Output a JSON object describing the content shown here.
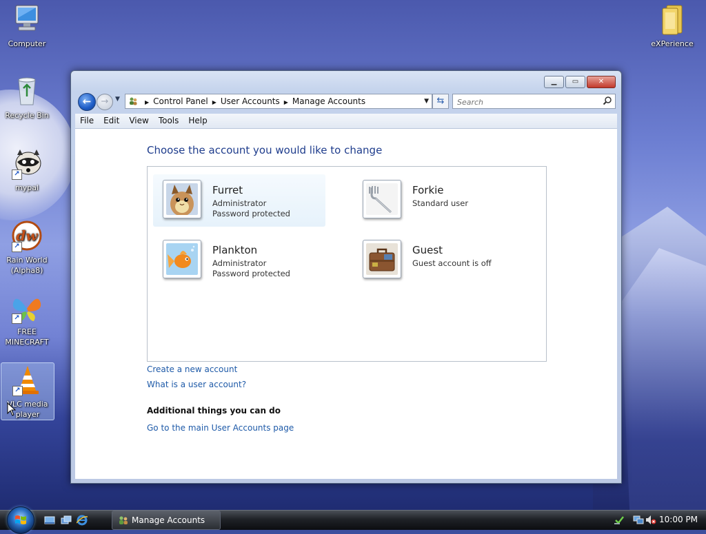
{
  "desktop": {
    "icons": [
      {
        "label": "Computer"
      },
      {
        "label": "Recycle Bin"
      },
      {
        "label": "mypal"
      },
      {
        "label": "Rain World (Alpha8)"
      },
      {
        "label": "FREE MINECRAFT"
      },
      {
        "label": "VLC media player"
      },
      {
        "label": "eXPerience"
      }
    ]
  },
  "window": {
    "title": "Manage Accounts",
    "breadcrumb": [
      "Control Panel",
      "User Accounts",
      "Manage Accounts"
    ],
    "search_placeholder": "Search",
    "menu": [
      "File",
      "Edit",
      "View",
      "Tools",
      "Help"
    ],
    "heading": "Choose the account you would like to change",
    "accounts": [
      {
        "name": "Furret",
        "lines": [
          "Administrator",
          "Password protected"
        ],
        "picture": "furret-avatar",
        "highlighted": true
      },
      {
        "name": "Forkie",
        "lines": [
          "Standard user"
        ],
        "picture": "fork-avatar",
        "highlighted": false
      },
      {
        "name": "Plankton",
        "lines": [
          "Administrator",
          "Password protected"
        ],
        "picture": "goldfish-avatar",
        "highlighted": false
      },
      {
        "name": "Guest",
        "lines": [
          "Guest account is off"
        ],
        "picture": "briefcase-avatar",
        "highlighted": false
      }
    ],
    "links": {
      "create": "Create a new account",
      "what_is": "What is a user account?"
    },
    "additional_heading": "Additional things you can do",
    "additional_link": "Go to the main User Accounts page"
  },
  "taskbar": {
    "active_task": "Manage Accounts",
    "clock": "10:00 PM"
  },
  "colors": {
    "link": "#1e5aa8",
    "heading": "#1e3c8c",
    "close_button": "#c2392c"
  }
}
